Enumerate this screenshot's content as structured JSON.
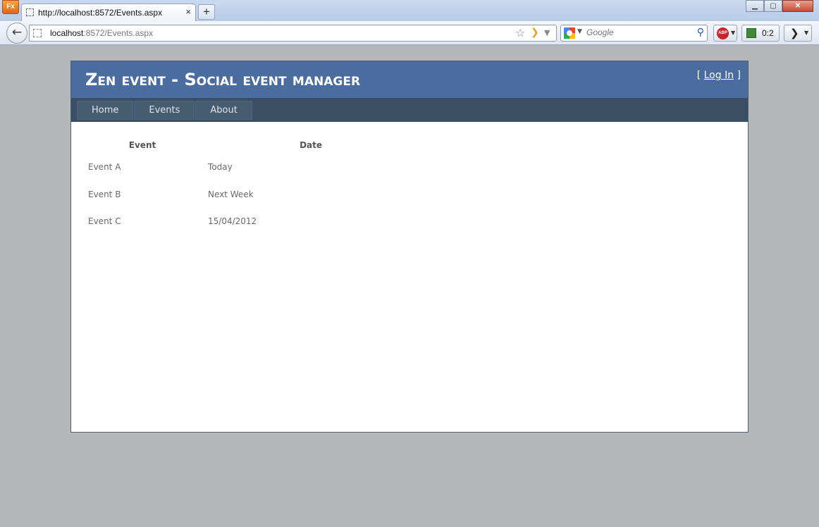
{
  "browser": {
    "app_button": "Fx",
    "tab_title": "http://localhost:8572/Events.aspx",
    "tab_close": "×",
    "new_tab": "+",
    "window_controls": {
      "minimize": "▁",
      "maximize": "▢",
      "close": "✕"
    },
    "back": "←",
    "url_host": "localhost",
    "url_path": ":8572/Events.aspx",
    "search_placeholder": "Google",
    "abp_label": "ABP",
    "notification_count": "0:2",
    "overflow": "❯"
  },
  "site": {
    "title": "Zen event - Social event manager",
    "login_open": "[ ",
    "login_link": "Log In",
    "login_close": " ]",
    "menu": [
      {
        "label": "Home"
      },
      {
        "label": "Events"
      },
      {
        "label": "About"
      }
    ]
  },
  "table": {
    "headers": {
      "event": "Event",
      "date": "Date"
    },
    "rows": [
      {
        "event": "Event A",
        "date": "Today"
      },
      {
        "event": "Event B",
        "date": "Next Week"
      },
      {
        "event": "Event C",
        "date": "15/04/2012"
      }
    ]
  },
  "colors": {
    "header_bg": "#4b6c9e",
    "menu_bg": "#3a4f63",
    "menu_item_bg": "#465c71",
    "page_bg": "#b5b7bb"
  }
}
